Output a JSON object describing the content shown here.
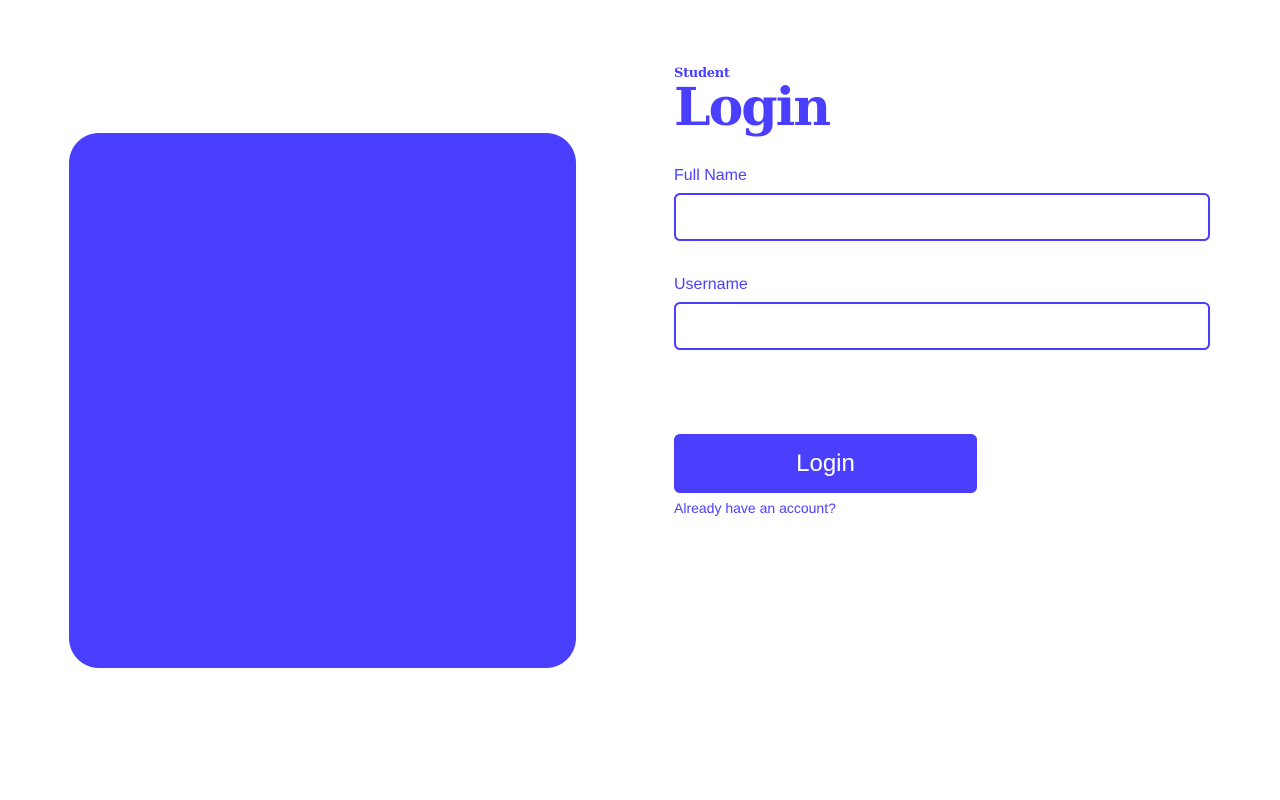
{
  "hero": {
    "color": "#4a3fff"
  },
  "form": {
    "subtitle": "Student",
    "title": "Login",
    "fields": {
      "full_name": {
        "label": "Full Name",
        "value": "",
        "placeholder": ""
      },
      "username": {
        "label": "Username",
        "value": "",
        "placeholder": ""
      }
    },
    "submit_label": "Login",
    "account_link": "Already have an account?"
  },
  "theme": {
    "accent": "#4a3fff",
    "background": "#ffffff"
  }
}
